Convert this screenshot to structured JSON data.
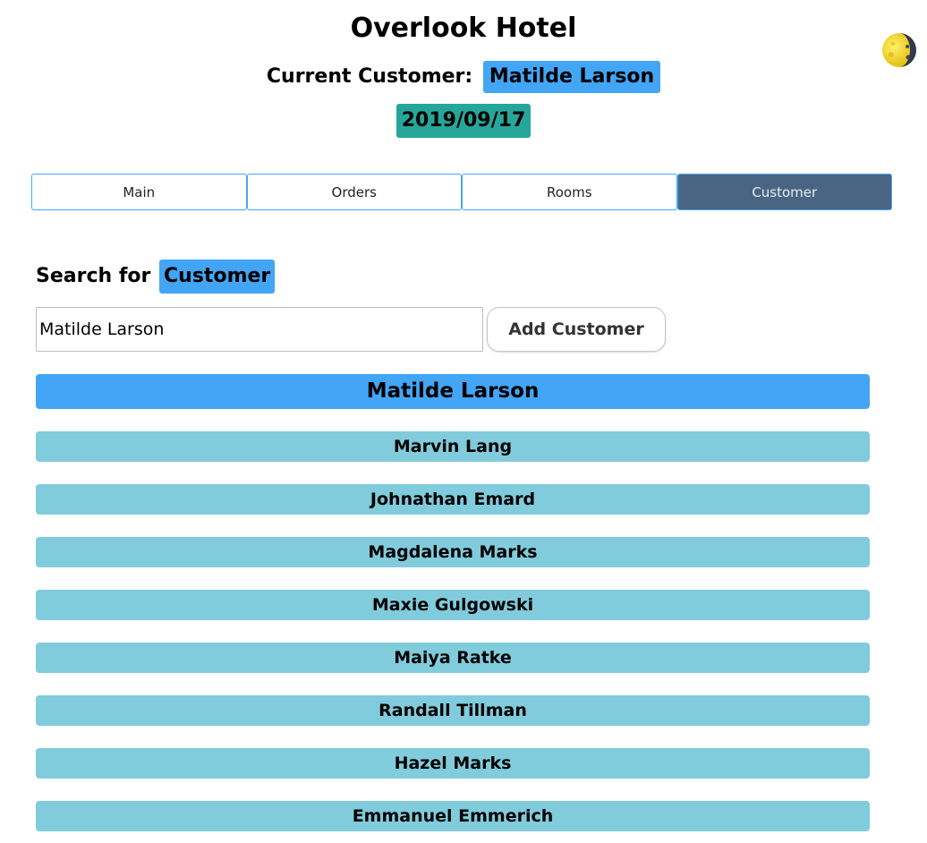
{
  "header": {
    "app_title": "Overlook Hotel",
    "current_customer_label": "Current Customer:",
    "current_customer_name": "Matilde Larson",
    "date": "2019/09/17",
    "theme_icon": "moon-phase-icon"
  },
  "tabs": [
    {
      "label": "Main",
      "active": false
    },
    {
      "label": "Orders",
      "active": false
    },
    {
      "label": "Rooms",
      "active": false
    },
    {
      "label": "Customer",
      "active": true
    }
  ],
  "search": {
    "heading_prefix": "Search for",
    "heading_highlight": "Customer",
    "input_value": "Matilde Larson",
    "add_button_label": "Add Customer"
  },
  "customers": {
    "selected": "Matilde Larson",
    "list": [
      "Marvin Lang",
      "Johnathan Emard",
      "Magdalena Marks",
      "Maxie Gulgowski",
      "Maiya Ratke",
      "Randall Tillman",
      "Hazel Marks",
      "Emmanuel Emmerich"
    ]
  },
  "colors": {
    "accent_blue": "#42a5f5",
    "date_teal": "#26a69a",
    "active_tab": "#4a6583",
    "list_item": "#80cbdc"
  }
}
